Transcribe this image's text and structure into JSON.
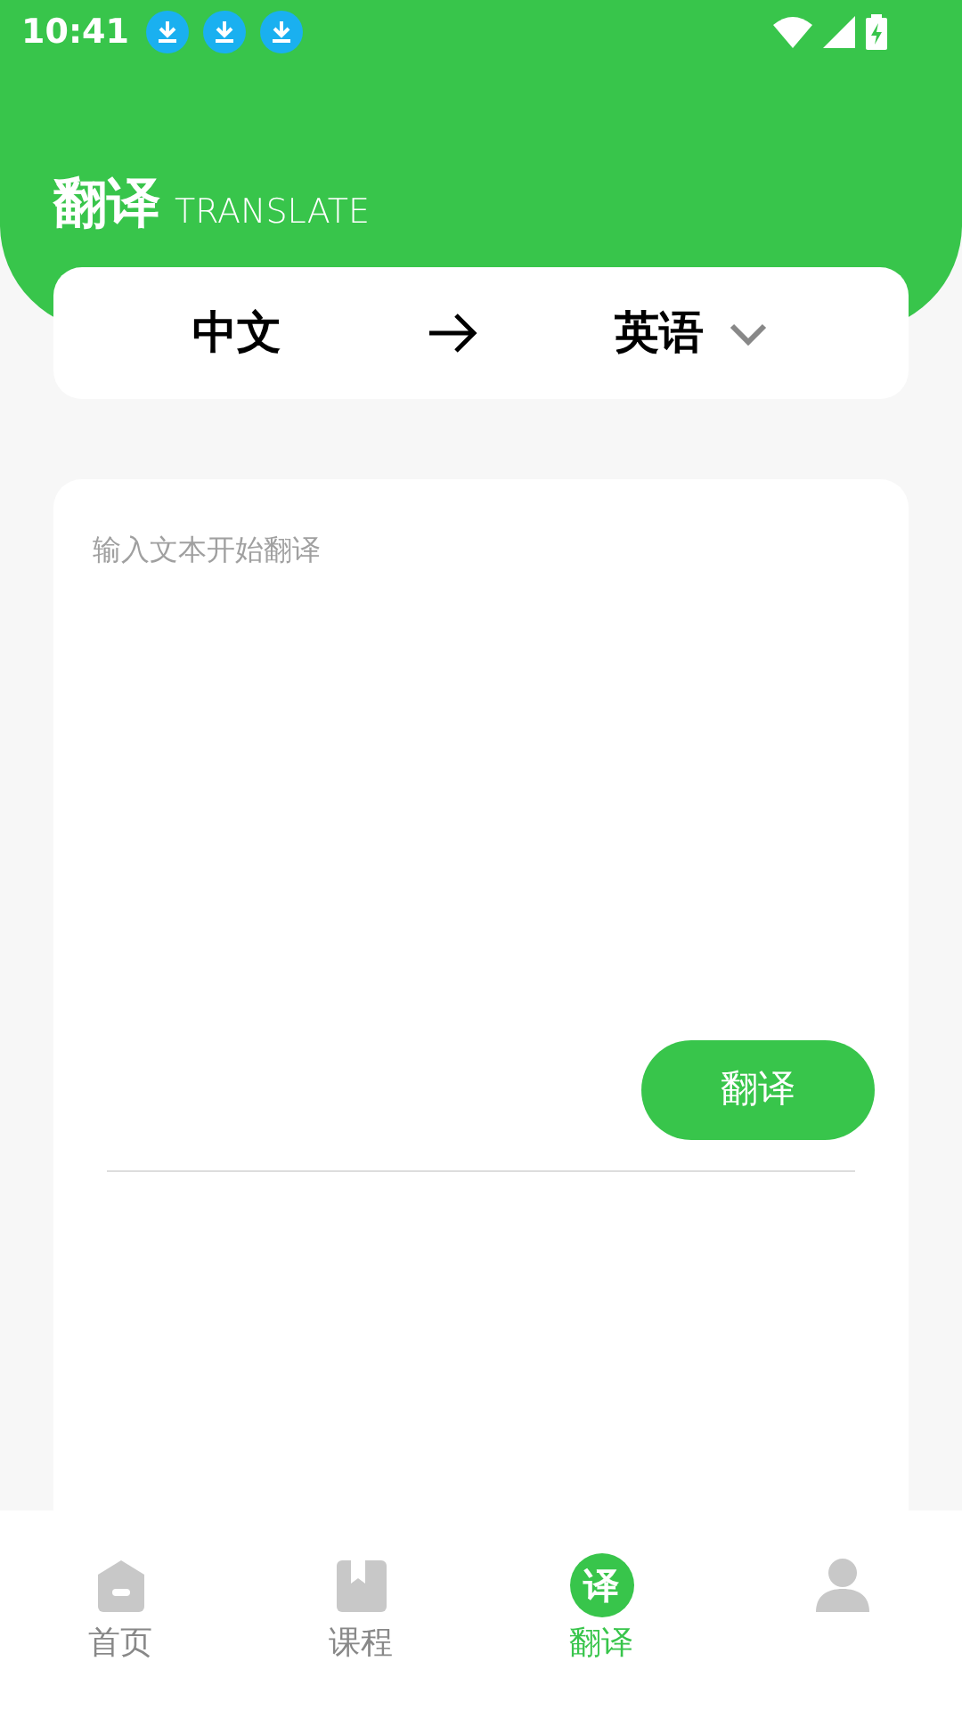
{
  "status_bar": {
    "time": "10:41",
    "notifications": [
      {
        "kind": "download"
      },
      {
        "kind": "download"
      },
      {
        "kind": "download"
      }
    ]
  },
  "header": {
    "title": "翻译",
    "subtitle": "TRANSLATE"
  },
  "language_bar": {
    "source": "中文",
    "target": "英语"
  },
  "input": {
    "placeholder": "输入文本开始翻译"
  },
  "translate_button": "翻译",
  "tabs": [
    {
      "kind": "home",
      "label": "首页",
      "selected": false
    },
    {
      "kind": "course",
      "label": "课程",
      "selected": false
    },
    {
      "kind": "translate",
      "label": "翻译",
      "icon_text": "译",
      "selected": true
    },
    {
      "kind": "profile",
      "selected": false
    }
  ]
}
